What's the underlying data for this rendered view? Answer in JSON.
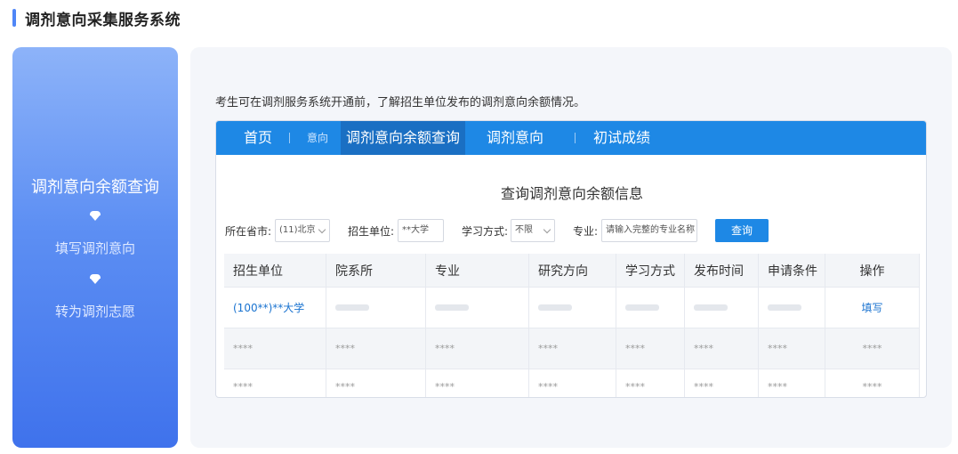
{
  "header": {
    "title": "调剂意向采集服务系统"
  },
  "steps": {
    "active": "调剂意向余额查询",
    "items": [
      "填写调剂意向",
      "转为调剂志愿"
    ]
  },
  "intro": "考生可在调剂服务系统开通前，了解招生单位发布的调剂意向余额情况。",
  "nav": {
    "home": "首页",
    "intent_small": "意向",
    "query": "调剂意向余额查询",
    "intent": "调剂意向",
    "scores": "初试成绩"
  },
  "card_heading": "查询调剂意向余额信息",
  "filters": {
    "province_label": "所在省市:",
    "province_value": "(11)北京",
    "unit_label": "招生单位:",
    "unit_value": "**大学",
    "mode_label": "学习方式:",
    "mode_value": "不限",
    "major_label": "专业:",
    "major_placeholder": "请输入完整的专业名称",
    "query_button": "查询"
  },
  "table": {
    "headers": [
      "招生单位",
      "院系所",
      "专业",
      "研究方向",
      "学习方式",
      "发布时间",
      "申请条件",
      "操作"
    ],
    "row1_unit": "(100**)**大学",
    "row1_action": "填写",
    "masked": "****"
  },
  "colors": {
    "accent": "#1e88e5",
    "link": "#1a73d0",
    "panel_start": "#8db3f9",
    "panel_end": "#3f72ec"
  }
}
